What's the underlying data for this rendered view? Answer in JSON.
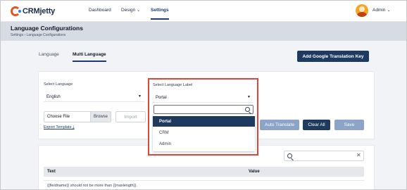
{
  "app": {
    "logo_text": "CRMjetty"
  },
  "nav": {
    "items": [
      "Dashboard",
      "Design",
      "Settings"
    ],
    "user": "Admin"
  },
  "header": {
    "title": "Language Configurations",
    "breadcrumb": "Settings  ›  Language Configurations"
  },
  "tabs": [
    "Language",
    "Multi Language"
  ],
  "add_key_label": "Add Google Translation Key",
  "select_language": {
    "label": "Select Language",
    "value": "English"
  },
  "select_language_label": {
    "label": "Select Language Label",
    "value": "Portal",
    "options": [
      "Portal",
      "CRM",
      "Admin"
    ]
  },
  "file": {
    "choose": "Choose File",
    "browse": "Browse",
    "import": "Import",
    "export": "Export Template ⤓"
  },
  "actions": {
    "auto_translate": "Auto Translate",
    "clear_all": "Clear All",
    "save": "Save"
  },
  "table": {
    "columns": [
      "Text",
      "Value"
    ],
    "rows": [
      "{{fieldname}} should not be more than {{maxlength}}."
    ]
  },
  "colors": {
    "brand_dark": "#1f3a5f",
    "highlight": "#e0453a",
    "light_button": "#8ba4c8"
  }
}
